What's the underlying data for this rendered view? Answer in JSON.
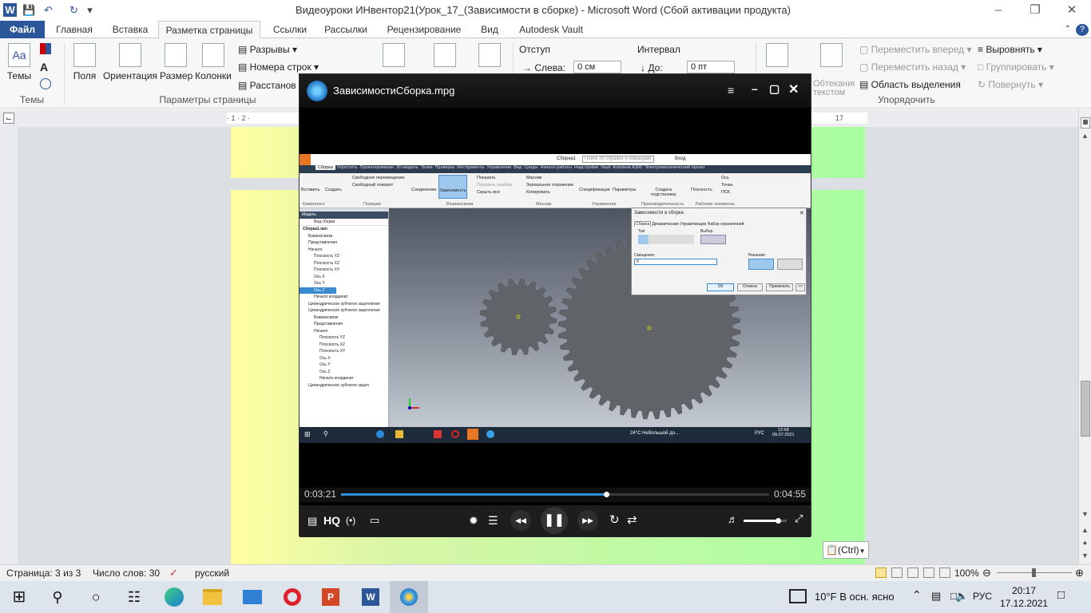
{
  "title_bar": {
    "title": "Видеоуроки ИНвентор21(Урок_17_(Зависимости в сборке)  -  Microsoft Word (Сбой активации продукта)"
  },
  "tabs": [
    "Файл",
    "Главная",
    "Вставка",
    "Разметка страницы",
    "Ссылки",
    "Рассылки",
    "Рецензирование",
    "Вид",
    "Autodesk Vault"
  ],
  "ribbon": {
    "themes": "Темы",
    "fields": "Поля",
    "orientation": "Ориентация",
    "size": "Размер",
    "columns": "Колонки",
    "breaks": "Разрывы",
    "line_numbers": "Номера строк",
    "hyphenation": "Расстанов",
    "group_themes": "Темы",
    "group_page_setup": "Параметры страницы",
    "indent": "Отступ",
    "left_label": "Слева:",
    "left_value": "0 см",
    "interval": "Интервал",
    "before_label": "До:",
    "before_value": "0 пт",
    "wrap_text": "Обтекание текстом",
    "bring_forward": "Переместить вперед",
    "send_backward": "Переместить назад",
    "selection_pane": "Область выделения",
    "align": "Выровнять",
    "group": "Группировать",
    "rotate": "Повернуть",
    "group_arrange": "Упорядочить"
  },
  "ruler": {
    "right_number": "17",
    "left_marks": "· 1 · 2 ·"
  },
  "player": {
    "title": "ЗависимостиСборка.mpg",
    "current_time": "0:03:21",
    "total_time": "0:04:55",
    "progress": 0.62,
    "volume": 0.8,
    "hq_label": "HQ"
  },
  "video": {
    "inventor_title": "Сборка1",
    "search_placeholder": "Поиск по справке и командам",
    "login": "Вход",
    "tabs": [
      "Сборка",
      "Упростить",
      "Проектирование",
      "3D-модель",
      "Эскиз",
      "Проверка",
      "Инструменты",
      "Управление",
      "Вид",
      "Среды",
      "Начало работы",
      "Надстройки",
      "Vault",
      "Autodesk A360",
      "Электромеханический проект"
    ],
    "buttons": [
      "Вставить",
      "Создать",
      "Свободное перемещение",
      "Свободный поворот",
      "Соединение",
      "Зависимость",
      "Показать",
      "Показать ошибки",
      "Скрыть все",
      "Массив",
      "Зеркальное отражение",
      "Копировать",
      "Спецификация",
      "Параметры",
      "Создать подстановку",
      "Плоскость",
      "Ось",
      "Точка",
      "ПСК"
    ],
    "groups": [
      "Компонент",
      "Позиция",
      "Взаимосвязи",
      "Массив",
      "Управление",
      "Производительность",
      "Рабочие элементы"
    ],
    "tree_header": "Модель",
    "tree_view": "Вид сборки",
    "tree_items": [
      "Сборка1.iam",
      "Взаимосвязи",
      "Представления",
      "Начало",
      "Плоскость YZ",
      "Плоскость XZ",
      "Плоскость XY",
      "Ось X",
      "Ось Y",
      "Ось Z",
      "Начало координат",
      "Цилиндрическое зубчатое зацепление",
      "Цилиндрическое зубчатое зацепление",
      "Взаимосвязи",
      "Представления",
      "Начало",
      "Плоскость YZ",
      "Плоскость XZ",
      "Плоскость XY",
      "Ось X",
      "Ось Y",
      "Ось Z",
      "Начало координат",
      "Цилиндрическое зубчатое зацеп"
    ],
    "dialog": {
      "title": "Зависимости в сборке",
      "tabs": [
        "Сборка",
        "Динамические",
        "Управляющие",
        "Набор ограничений"
      ],
      "type_label": "Тип",
      "select_label": "Выбор",
      "offset_label": "Смещение:",
      "offset_value": "0",
      "solution_label": "Решение",
      "ok": "ОК",
      "cancel": "Отмена",
      "apply": "Применить",
      "more": ">>"
    },
    "win_time": "12:58",
    "win_date": "09.07.2021",
    "win_weather": "24°C  Небольшой до...",
    "win_lang": "РУС"
  },
  "paste_tag": "(Ctrl)",
  "status": {
    "page": "Страница: 3 из 3",
    "words": "Число слов: 30",
    "language": "русский",
    "zoom": "100%"
  },
  "taskbar": {
    "weather": "10°F  В осн. ясно",
    "lang": "РУС",
    "time": "20:17",
    "date": "17.12.2021"
  }
}
